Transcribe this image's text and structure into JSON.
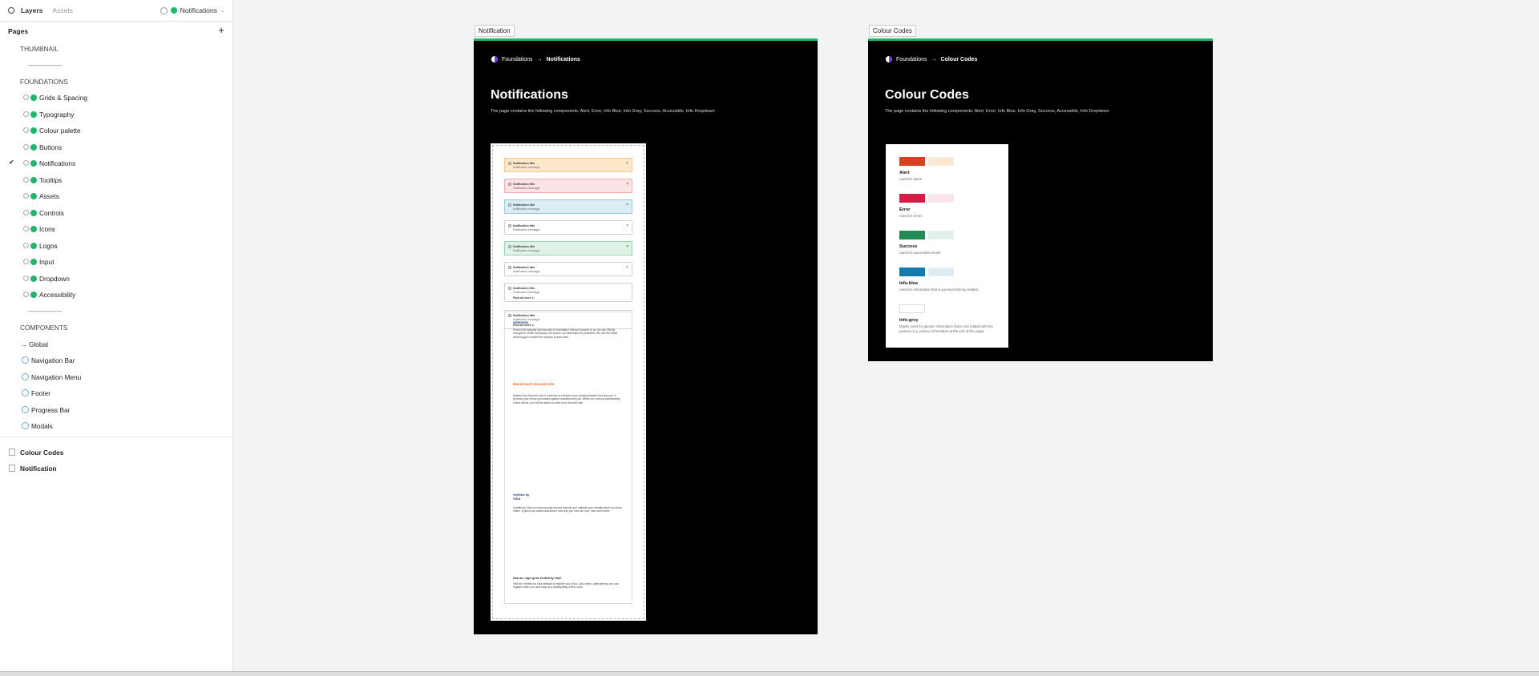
{
  "topbar": {
    "tab_layers": "Layers",
    "tab_assets": "Assets",
    "file_name": "Notifications"
  },
  "pages": {
    "header": "Pages",
    "add_icon": "+",
    "items": [
      {
        "label": "THUMBNAIL",
        "type": "section"
      },
      {
        "label": "-----------------------",
        "type": "sep"
      },
      {
        "label": "FOUNDATIONS",
        "type": "section"
      },
      {
        "label": "Grids & Spacing",
        "type": "page"
      },
      {
        "label": "Typography",
        "type": "page"
      },
      {
        "label": "Colour palette",
        "type": "page"
      },
      {
        "label": "Buttons",
        "type": "page"
      },
      {
        "label": "Notifications",
        "type": "page",
        "current": true
      },
      {
        "label": "Tooltips",
        "type": "page"
      },
      {
        "label": "Assets",
        "type": "page"
      },
      {
        "label": "Controls",
        "type": "page"
      },
      {
        "label": "Icons",
        "type": "page"
      },
      {
        "label": "Logos",
        "type": "page"
      },
      {
        "label": "Input",
        "type": "page"
      },
      {
        "label": "Dropdown",
        "type": "page"
      },
      {
        "label": "Accessibility",
        "type": "page"
      },
      {
        "label": "-----------------------",
        "type": "sep"
      },
      {
        "label": "COMPONENTS",
        "type": "section"
      },
      {
        "label": "Global",
        "type": "arrow"
      },
      {
        "label": "Navigation Bar",
        "type": "comp"
      },
      {
        "label": "Navigation Menu",
        "type": "comp"
      },
      {
        "label": "Footer",
        "type": "comp"
      },
      {
        "label": "Progress Bar",
        "type": "comp"
      },
      {
        "label": "Modals",
        "type": "comp"
      }
    ],
    "files": [
      {
        "label": "Colour Codes"
      },
      {
        "label": "Notification"
      }
    ]
  },
  "frame_notification": {
    "tag": "Notification",
    "crumb_parent": "Foundations",
    "crumb_arrow": "→",
    "crumb_current": "Notifications",
    "title": "Notifications",
    "desc": "The page contains the following components: Alert, Error, Info Blue, Info Gray, Success, Accessible, Info Dropdown",
    "alerts": [
      {
        "title": "Notification title",
        "message": "Notification message",
        "bg": "#fde8c9",
        "border": "#f3c98b",
        "close": "×"
      },
      {
        "title": "Notification title",
        "message": "Notification message",
        "bg": "#fbe3e6",
        "border": "#f0aab4",
        "close": "×"
      },
      {
        "title": "Notification title",
        "message": "Notification message",
        "bg": "#dcecf4",
        "border": "#9cc7dd",
        "close": "×"
      },
      {
        "title": "Notification title",
        "message": "Notification message",
        "bg": "#ffffff",
        "border": "#d2d2d2",
        "close": "×"
      },
      {
        "title": "Notification title",
        "message": "Notification message",
        "bg": "#dff2e6",
        "border": "#99d3b0",
        "close": "×"
      },
      {
        "title": "Notification title",
        "message": "Notification message",
        "bg": "#ffffff",
        "border": "#d2d2d2",
        "close": "×"
      },
      {
        "title": "Notification title",
        "message": "Notification message",
        "bg": "#ffffff",
        "border": "#d2d2d2",
        "more": "Find out more ∨"
      },
      {
        "title": "Notification title",
        "message": "Notification message",
        "bg": "#ffffff",
        "border": "#d2d2d2",
        "more": "Find out more ∧"
      }
    ],
    "panel": {
      "verisign_logo": "VERISIGN",
      "verisign_text": "Protect the integrity and security of information that you provide to us, we use 256-bit encryption. When necessary, we ensure our information is protected. We use the latest technology to ensure the security of your data.",
      "mastercard_logo": "Mastercard SecureCode",
      "mastercard_text": "MasterCard SecureCode is a service to enhance your existing MasterCard account. It protects your online purchases against unauthorized use. When you shop at participating online stores, you will be asked to enter your SecureCode.",
      "visa_logo": "Verified by VISA",
      "visa_text": "Verified by Visa is a new security service that lets you validate your identity when you shop online. It gives you added assurance that only you can use your Visa card online.",
      "faq_title": "How do I sign up for Verified by Visa?",
      "faq_text": "Visit the Verified by Visa website to register your Visa Card online. Alternatively, you can register when you next shop at a participating online store."
    }
  },
  "frame_colour": {
    "tag": "Colour Codes",
    "crumb_parent": "Foundations",
    "crumb_arrow": "→",
    "crumb_current": "Colour Codes",
    "title": "Colour Codes",
    "desc": "The page contains the following components: Alert, Error, Info Blue, Info Gray, Success, Accessible, Info Dropdown",
    "codes": [
      {
        "name": "Alert",
        "desc": "Used for alerts",
        "primary": "#d9411e",
        "secondary": "#fde8cf"
      },
      {
        "name": "Error",
        "desc": "Used for errors",
        "primary": "#d41c46",
        "secondary": "#fbe3e8"
      },
      {
        "name": "Success",
        "desc": "Used for successful events",
        "primary": "#238a56",
        "secondary": "#e0f2e8"
      },
      {
        "name": "Info-blue",
        "desc": "Used for information that is journey/ordering related",
        "primary": "#137aad",
        "secondary": "#dcecf5"
      },
      {
        "name": "Info-grey",
        "desc": "Mainly used for generic information that is not related with the journey (e.g. privacy information at the end of the page)",
        "primary": "#ffffff",
        "secondary": ""
      }
    ]
  }
}
